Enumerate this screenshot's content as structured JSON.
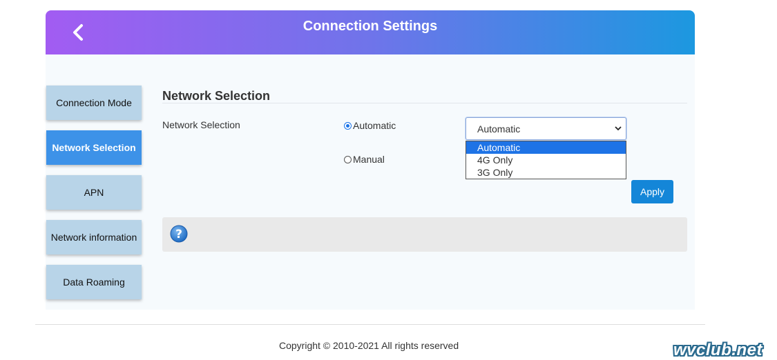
{
  "header": {
    "title": "Connection Settings",
    "back_icon": "chevron-left-icon"
  },
  "sidebar": {
    "items": [
      {
        "label": "Connection Mode",
        "active": false
      },
      {
        "label": "Network Selection",
        "active": true
      },
      {
        "label": "APN",
        "active": false
      },
      {
        "label": "Network information",
        "active": false
      },
      {
        "label": "Data Roaming",
        "active": false
      }
    ]
  },
  "main": {
    "section_title": "Network Selection",
    "field_label": "Network Selection",
    "radios": [
      {
        "label": "Automatic",
        "checked": true
      },
      {
        "label": "Manual",
        "checked": false
      }
    ],
    "select": {
      "value": "Automatic",
      "options": [
        "Automatic",
        "4G Only",
        "3G Only"
      ],
      "highlighted": "Automatic"
    },
    "apply_label": "Apply",
    "help_icon": "question-circle-icon"
  },
  "footer": {
    "copyright": "Copyright © 2010-2021 All rights reserved"
  },
  "watermark": "wvclub.net",
  "colors": {
    "header_gradient": [
      "#a25cf2",
      "#6f74ea",
      "#1c98e0"
    ],
    "sidebar_active": "#3d92e8",
    "sidebar_inactive": "#b8d4e8",
    "apply_button": "#1486d8",
    "option_highlight": "#1e73e6"
  }
}
